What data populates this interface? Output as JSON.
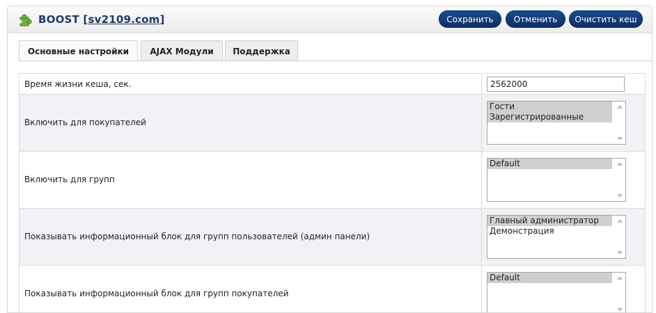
{
  "header": {
    "title": "BOOST",
    "domain": "[sv2109.com]",
    "buttons": {
      "save": "Сохранить",
      "cancel": "Отменить",
      "clear_cache": "Очистить кеш"
    }
  },
  "tabs": [
    "Основные настройки",
    "AJAX Модули",
    "Поддержка"
  ],
  "settings": [
    {
      "label": "Время жизни кеша, сек.",
      "value": "2562000"
    },
    {
      "label": "Включить для покупателей",
      "options": [
        "Гости",
        "Зарегистрированные"
      ]
    },
    {
      "label": "Включить для групп",
      "options": [
        "Default"
      ]
    },
    {
      "label": "Показывать информационный блок для групп пользователей (админ панели)",
      "options": [
        "Главный администратор",
        "Демонстрация"
      ]
    },
    {
      "label": "Показывать информационный блок для групп покупателей",
      "options": [
        "Default"
      ]
    }
  ],
  "colors": {
    "button": "#0b2f66",
    "title": "#1e3a6c",
    "alt_row": "#f1f2f5"
  }
}
